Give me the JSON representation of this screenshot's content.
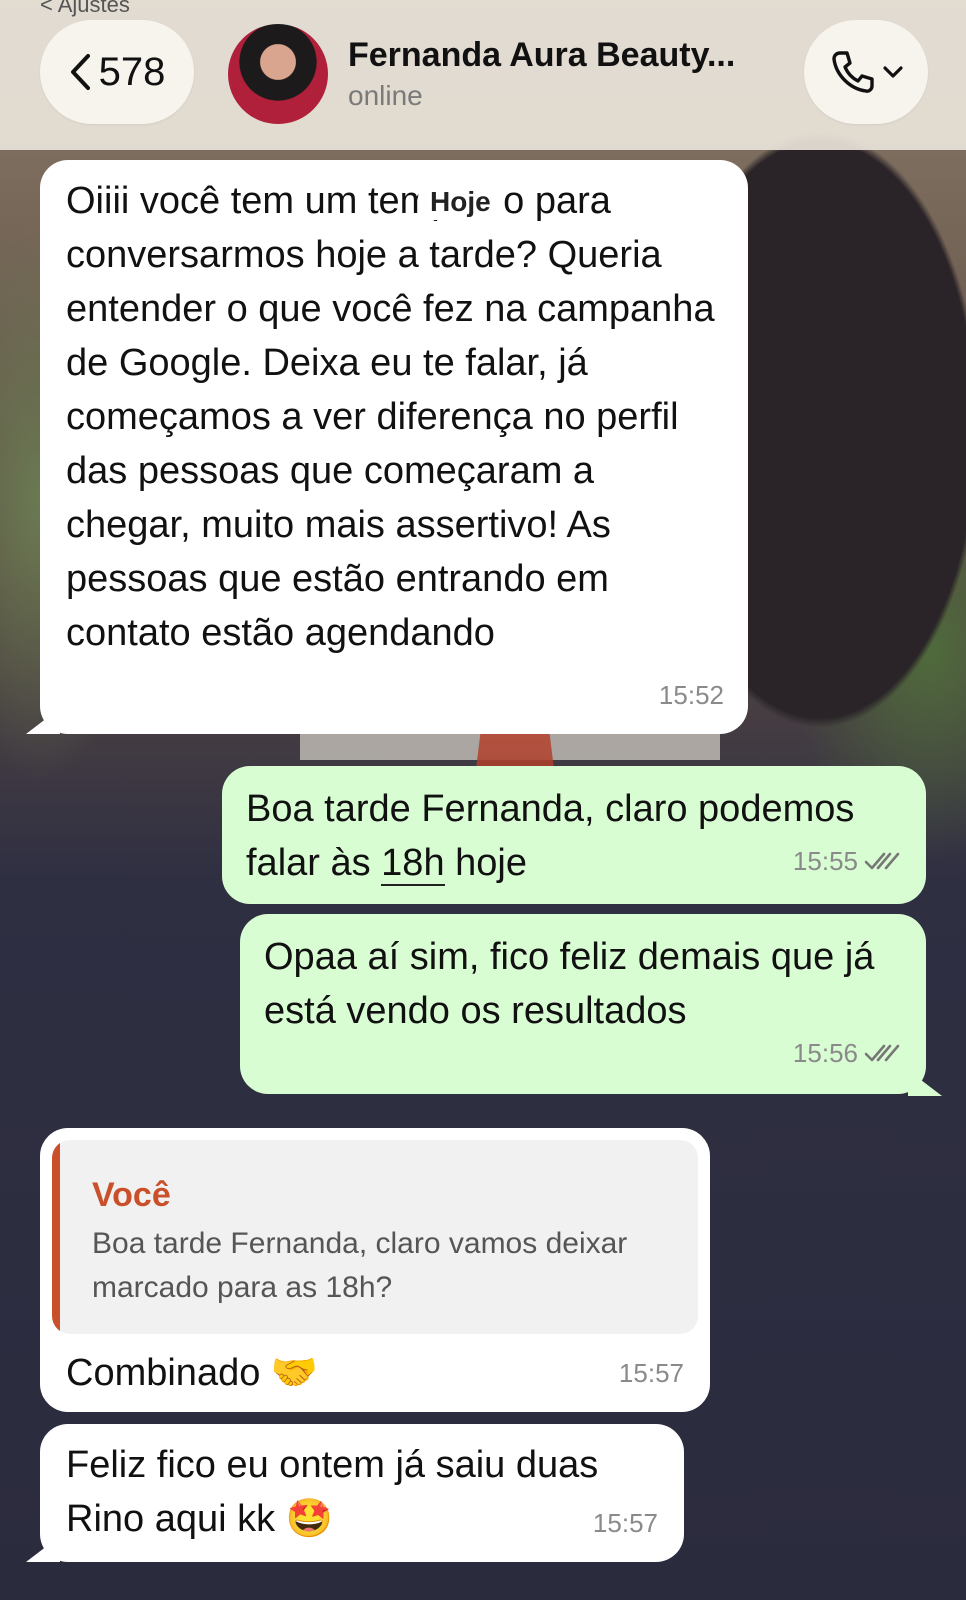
{
  "header": {
    "settings_back_label": "< Ajustes",
    "back_count": "578",
    "contact_name": "Fernanda Aura Beauty...",
    "contact_status": "online"
  },
  "date_chip": "Hoje",
  "messages": [
    {
      "direction": "incoming",
      "text": "Oiiii você tem um tempinho para conversarmos hoje a tarde? Queria entender o que você fez na campanha de Google. Deixa eu te falar, já começamos a ver diferença no perfil das pessoas que começaram a chegar, muito mais assertivo! As pessoas que estão entrando em contato estão agendando",
      "time": "15:52"
    },
    {
      "direction": "outgoing",
      "text_before": "Boa tarde Fernanda, claro podemos falar às ",
      "text_link": "18h",
      "text_after": " hoje",
      "time": "15:55",
      "status": "read"
    },
    {
      "direction": "outgoing",
      "text": "Opaa aí sim, fico feliz demais que já está vendo os resultados",
      "time": "15:56",
      "status": "read"
    },
    {
      "direction": "incoming",
      "quote": {
        "author": "Você",
        "text": "Boa tarde Fernanda, claro vamos deixar marcado para as 18h?"
      },
      "text": "Combinado 🤝",
      "time": "15:57"
    },
    {
      "direction": "incoming",
      "text": "Feliz fico eu ontem já saiu duas Rino aqui kk 🤩",
      "time": "15:57"
    }
  ],
  "colors": {
    "incoming_bubble": "#ffffff",
    "outgoing_bubble": "#d9fdd3",
    "quote_accent": "#c9502a"
  }
}
